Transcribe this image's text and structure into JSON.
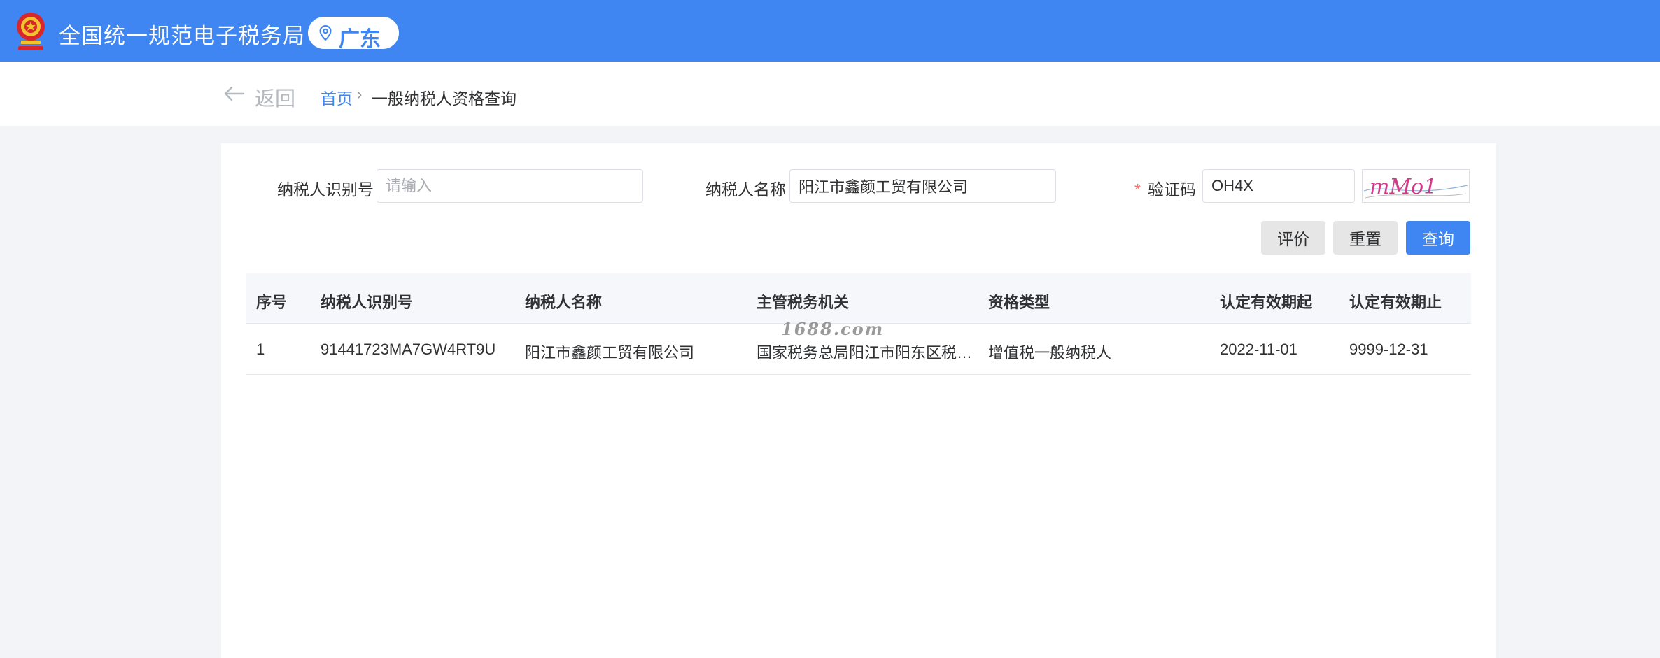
{
  "header": {
    "title": "全国统一规范电子税务局",
    "region": "广东",
    "emblem_icon": "national-emblem-icon",
    "pin_icon": "location-pin-icon",
    "bg_color": "#3f86f2"
  },
  "breadcrumb": {
    "back_label": "返回",
    "home": "首页",
    "separator": "›",
    "current": "一般纳税人资格查询"
  },
  "form": {
    "taxpayer_id_label": "纳税人识别号",
    "taxpayer_id_placeholder": "请输入",
    "taxpayer_id_value": "",
    "taxpayer_name_label": "纳税人名称",
    "taxpayer_name_value": "阳江市鑫颜工贸有限公司",
    "captcha_required_mark": "*",
    "captcha_label": "验证码",
    "captcha_value": "OH4X",
    "captcha_image_text": "mMo1"
  },
  "buttons": {
    "evaluate": "评价",
    "reset": "重置",
    "query": "查询"
  },
  "table": {
    "columns": [
      "序号",
      "纳税人识别号",
      "纳税人名称",
      "主管税务机关",
      "资格类型",
      "认定有效期起",
      "认定有效期止"
    ],
    "rows": [
      [
        "1",
        "91441723MA7GW4RT9U",
        "阳江市鑫颜工贸有限公司",
        "国家税务总局阳江市阳东区税…",
        "增值税一般纳税人",
        "2022-11-01",
        "9999-12-31"
      ]
    ]
  },
  "watermark": "1688.com"
}
